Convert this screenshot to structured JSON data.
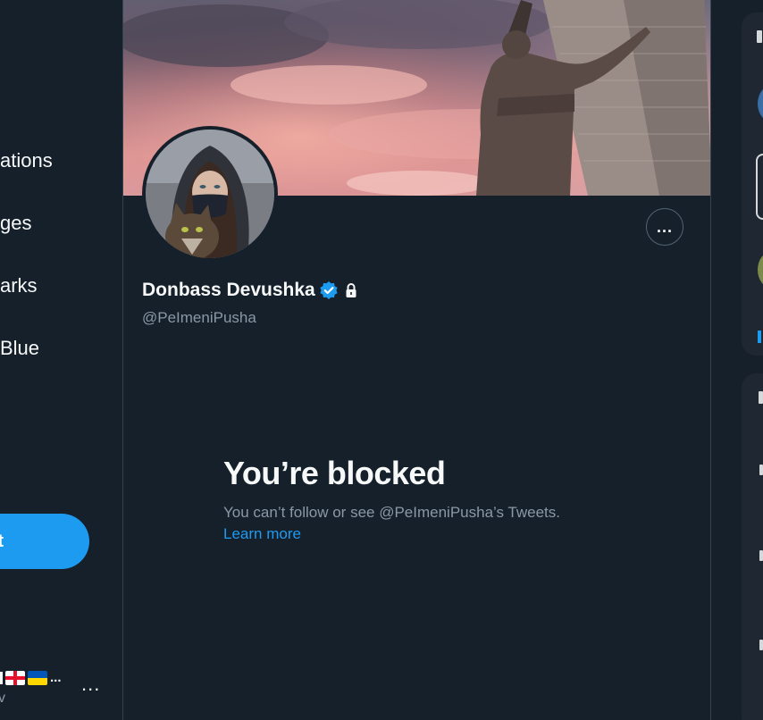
{
  "left_nav": {
    "items": [
      {
        "label": "ations"
      },
      {
        "label": "ges"
      },
      {
        "label": "arks"
      },
      {
        "label": "Blue"
      }
    ],
    "tweet_button_label": "t",
    "account": {
      "name_suffix": "...",
      "handle": "v",
      "flags": [
        "georgia-flag",
        "ukraine-flag"
      ],
      "more_label": "..."
    }
  },
  "profile": {
    "display_name": "Donbass Devushka",
    "handle": "@PeImeniPusha",
    "verified": true,
    "protected": true,
    "more_label": "...",
    "icons": [
      "verified-badge-icon",
      "lock-icon",
      "more-icon"
    ]
  },
  "blocked": {
    "title": "You’re blocked",
    "description": "You can’t follow or see @PeImeniPusha’s Tweets.",
    "link": "Learn more"
  },
  "colors": {
    "background": "#15202b",
    "text": "#f7f9f9",
    "secondary_text": "#8b98a5",
    "accent": "#1d9bf0",
    "border": "#38444d",
    "card": "#1e2732"
  }
}
